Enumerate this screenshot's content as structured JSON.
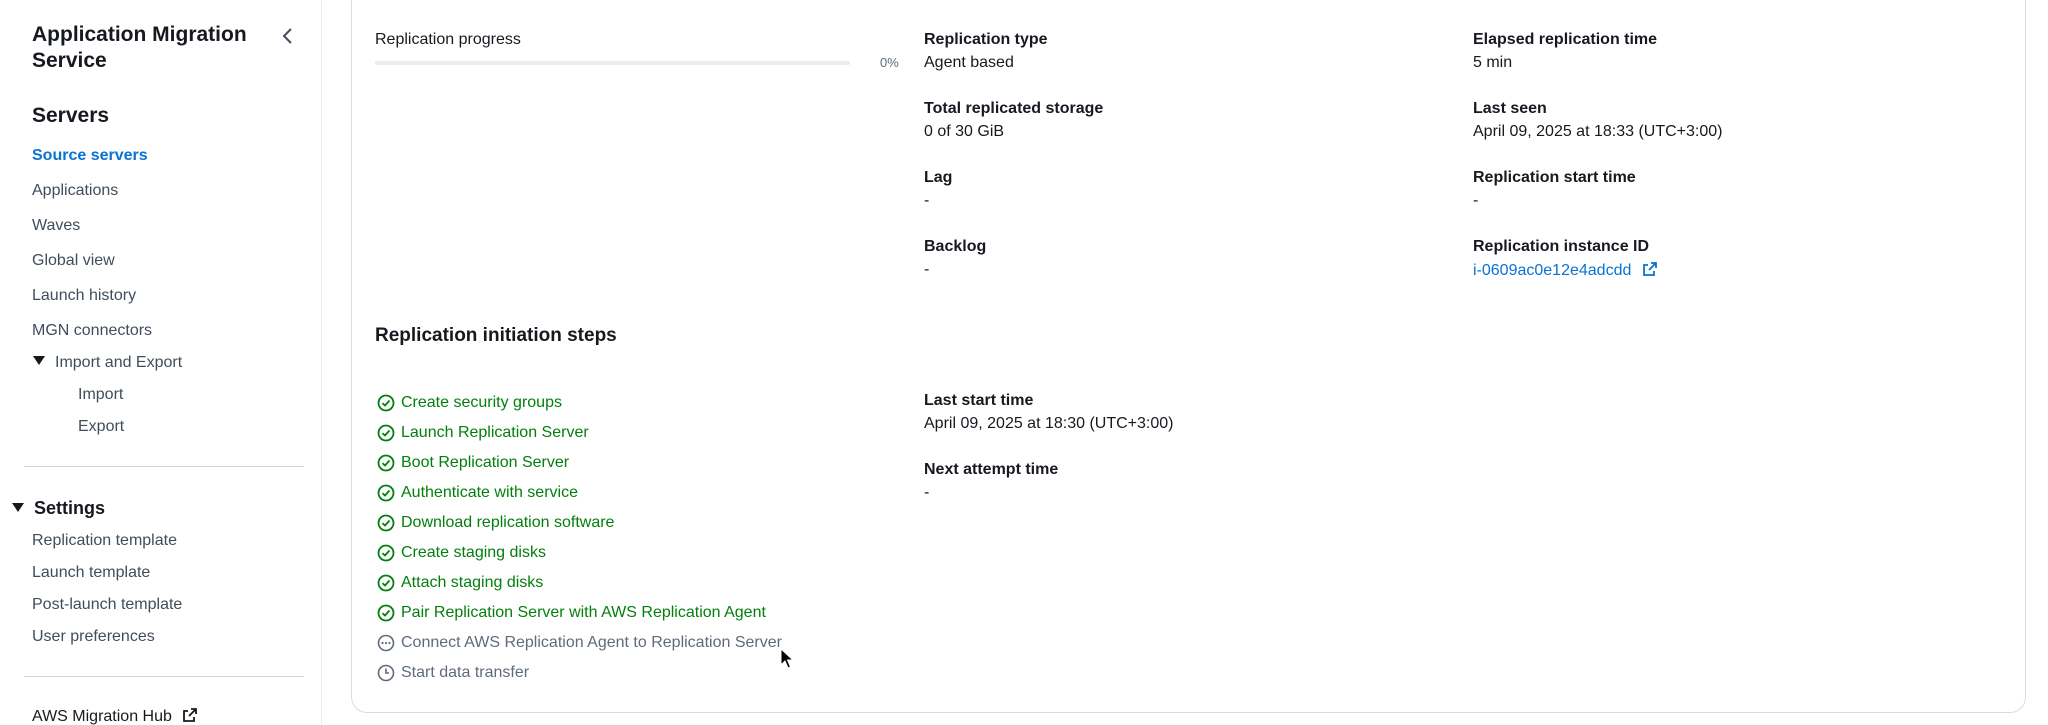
{
  "sidebar": {
    "title": "Application Migration Service",
    "servers_heading": "Servers",
    "items": [
      {
        "label": "Source servers",
        "active": true
      },
      {
        "label": "Applications"
      },
      {
        "label": "Waves"
      },
      {
        "label": "Global view"
      },
      {
        "label": "Launch history"
      },
      {
        "label": "MGN connectors"
      }
    ],
    "import_export": {
      "label": "Import and Export",
      "children": [
        "Import",
        "Export"
      ]
    },
    "settings": {
      "label": "Settings",
      "items": [
        "Replication template",
        "Launch template",
        "Post-launch template",
        "User preferences"
      ]
    },
    "migration_hub": "AWS Migration Hub"
  },
  "replication": {
    "progress_label": "Replication progress",
    "progress_value": 0,
    "progress_text": "0%",
    "replication_type": {
      "label": "Replication type",
      "value": "Agent based"
    },
    "total_storage": {
      "label": "Total replicated storage",
      "value": "0 of 30 GiB"
    },
    "lag": {
      "label": "Lag",
      "value": "-"
    },
    "backlog": {
      "label": "Backlog",
      "value": "-"
    },
    "elapsed_time": {
      "label": "Elapsed replication time",
      "value": "5 min"
    },
    "last_seen": {
      "label": "Last seen",
      "value": "April 09, 2025 at 18:33 (UTC+3:00)"
    },
    "start_time": {
      "label": "Replication start time",
      "value": "-"
    },
    "instance_id": {
      "label": "Replication instance ID",
      "value": "i-0609ac0e12e4adcdd"
    }
  },
  "initiation": {
    "heading": "Replication initiation steps",
    "steps": [
      {
        "label": "Create security groups",
        "status": "done"
      },
      {
        "label": "Launch Replication Server",
        "status": "done"
      },
      {
        "label": "Boot Replication Server",
        "status": "done"
      },
      {
        "label": "Authenticate with service",
        "status": "done"
      },
      {
        "label": "Download replication software",
        "status": "done"
      },
      {
        "label": "Create staging disks",
        "status": "done"
      },
      {
        "label": "Attach staging disks",
        "status": "done"
      },
      {
        "label": "Pair Replication Server with AWS Replication Agent",
        "status": "done"
      },
      {
        "label": "Connect AWS Replication Agent to Replication Server",
        "status": "in-progress"
      },
      {
        "label": "Start data transfer",
        "status": "pending"
      }
    ],
    "last_start_time": {
      "label": "Last start time",
      "value": "April 09, 2025 at 18:30 (UTC+3:00)"
    },
    "next_attempt_time": {
      "label": "Next attempt time",
      "value": "-"
    }
  },
  "colors": {
    "success": "#037f0c",
    "link": "#0972d3",
    "pending": "#5f6b7a"
  },
  "icons": {
    "done": "check-circle-icon",
    "in-progress": "in-progress-circle-icon",
    "pending": "clock-icon"
  }
}
